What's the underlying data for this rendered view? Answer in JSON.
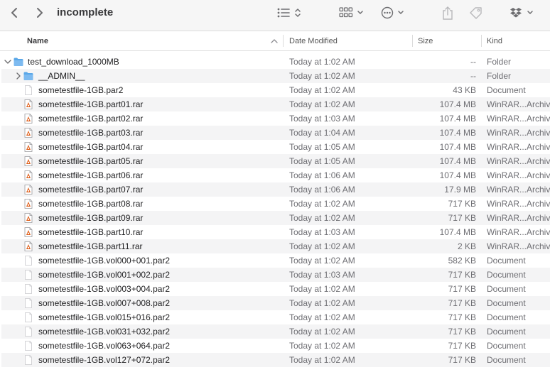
{
  "window": {
    "title": "incomplete"
  },
  "toolbar": {
    "back_icon": "chevron-left-icon",
    "forward_icon": "chevron-right-icon",
    "list_view_icon": "list-view-icon",
    "group_icon": "group-by-icon",
    "more_icon": "ellipsis-circle-icon",
    "share_icon": "share-icon",
    "tag_icon": "tag-icon",
    "dropbox_icon": "dropbox-icon"
  },
  "columns": {
    "name": "Name",
    "date": "Date Modified",
    "size": "Size",
    "kind": "Kind"
  },
  "rows": [
    {
      "name": "test_download_1000MB",
      "date": "Today at 1:02 AM",
      "size": "--",
      "kind": "Folder",
      "icon": "folder-icon",
      "disclosure": "expanded",
      "indent": 0
    },
    {
      "name": "__ADMIN__",
      "date": "Today at 1:02 AM",
      "size": "--",
      "kind": "Folder",
      "icon": "folder-icon",
      "disclosure": "collapsed",
      "indent": 1
    },
    {
      "name": "sometestfile-1GB.par2",
      "date": "Today at 1:02 AM",
      "size": "43 KB",
      "kind": "Document",
      "icon": "document-icon",
      "indent": 1
    },
    {
      "name": "sometestfile-1GB.part01.rar",
      "date": "Today at 1:02 AM",
      "size": "107.4 MB",
      "kind": "WinRAR...Archive",
      "icon": "rar-archive-icon",
      "indent": 1
    },
    {
      "name": "sometestfile-1GB.part02.rar",
      "date": "Today at 1:03 AM",
      "size": "107.4 MB",
      "kind": "WinRAR...Archive",
      "icon": "rar-archive-icon",
      "indent": 1
    },
    {
      "name": "sometestfile-1GB.part03.rar",
      "date": "Today at 1:04 AM",
      "size": "107.4 MB",
      "kind": "WinRAR...Archive",
      "icon": "rar-archive-icon",
      "indent": 1
    },
    {
      "name": "sometestfile-1GB.part04.rar",
      "date": "Today at 1:05 AM",
      "size": "107.4 MB",
      "kind": "WinRAR...Archive",
      "icon": "rar-archive-icon",
      "indent": 1
    },
    {
      "name": "sometestfile-1GB.part05.rar",
      "date": "Today at 1:05 AM",
      "size": "107.4 MB",
      "kind": "WinRAR...Archive",
      "icon": "rar-archive-icon",
      "indent": 1
    },
    {
      "name": "sometestfile-1GB.part06.rar",
      "date": "Today at 1:06 AM",
      "size": "107.4 MB",
      "kind": "WinRAR...Archive",
      "icon": "rar-archive-icon",
      "indent": 1
    },
    {
      "name": "sometestfile-1GB.part07.rar",
      "date": "Today at 1:06 AM",
      "size": "17.9 MB",
      "kind": "WinRAR...Archive",
      "icon": "rar-archive-icon",
      "indent": 1
    },
    {
      "name": "sometestfile-1GB.part08.rar",
      "date": "Today at 1:02 AM",
      "size": "717 KB",
      "kind": "WinRAR...Archive",
      "icon": "rar-archive-icon",
      "indent": 1
    },
    {
      "name": "sometestfile-1GB.part09.rar",
      "date": "Today at 1:02 AM",
      "size": "717 KB",
      "kind": "WinRAR...Archive",
      "icon": "rar-archive-icon",
      "indent": 1
    },
    {
      "name": "sometestfile-1GB.part10.rar",
      "date": "Today at 1:03 AM",
      "size": "107.4 MB",
      "kind": "WinRAR...Archive",
      "icon": "rar-archive-icon",
      "indent": 1
    },
    {
      "name": "sometestfile-1GB.part11.rar",
      "date": "Today at 1:02 AM",
      "size": "2 KB",
      "kind": "WinRAR...Archive",
      "icon": "rar-archive-icon",
      "indent": 1
    },
    {
      "name": "sometestfile-1GB.vol000+001.par2",
      "date": "Today at 1:02 AM",
      "size": "582 KB",
      "kind": "Document",
      "icon": "document-icon",
      "indent": 1
    },
    {
      "name": "sometestfile-1GB.vol001+002.par2",
      "date": "Today at 1:03 AM",
      "size": "717 KB",
      "kind": "Document",
      "icon": "document-icon",
      "indent": 1
    },
    {
      "name": "sometestfile-1GB.vol003+004.par2",
      "date": "Today at 1:02 AM",
      "size": "717 KB",
      "kind": "Document",
      "icon": "document-icon",
      "indent": 1
    },
    {
      "name": "sometestfile-1GB.vol007+008.par2",
      "date": "Today at 1:02 AM",
      "size": "717 KB",
      "kind": "Document",
      "icon": "document-icon",
      "indent": 1
    },
    {
      "name": "sometestfile-1GB.vol015+016.par2",
      "date": "Today at 1:02 AM",
      "size": "717 KB",
      "kind": "Document",
      "icon": "document-icon",
      "indent": 1
    },
    {
      "name": "sometestfile-1GB.vol031+032.par2",
      "date": "Today at 1:02 AM",
      "size": "717 KB",
      "kind": "Document",
      "icon": "document-icon",
      "indent": 1
    },
    {
      "name": "sometestfile-1GB.vol063+064.par2",
      "date": "Today at 1:02 AM",
      "size": "717 KB",
      "kind": "Document",
      "icon": "document-icon",
      "indent": 1
    },
    {
      "name": "sometestfile-1GB.vol127+072.par2",
      "date": "Today at 1:02 AM",
      "size": "717 KB",
      "kind": "Document",
      "icon": "document-icon",
      "indent": 1
    }
  ],
  "colors": {
    "folder": "#5aa7e8",
    "rar_accent": "#e0621f",
    "stripe": "#f4f4f5"
  }
}
